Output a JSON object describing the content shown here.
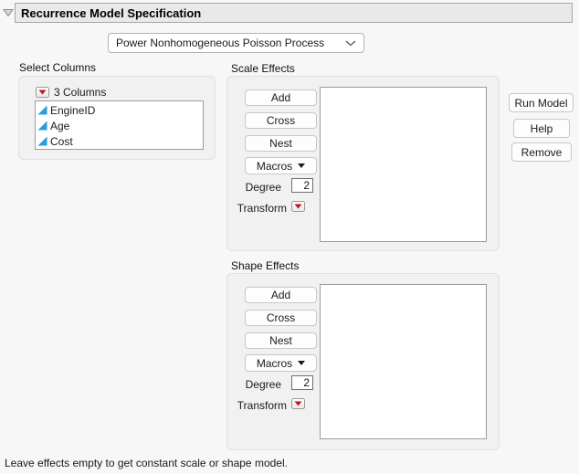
{
  "header": {
    "title": "Recurrence Model Specification"
  },
  "model_selector": {
    "value": "Power Nonhomogeneous Poisson Process"
  },
  "select_columns": {
    "label": "Select Columns",
    "menu_label": "3 Columns",
    "columns": [
      {
        "name": "EngineID",
        "icon": "continuous-column-icon"
      },
      {
        "name": "Age",
        "icon": "continuous-column-icon"
      },
      {
        "name": "Cost",
        "icon": "continuous-column-icon"
      }
    ]
  },
  "scale_effects": {
    "label": "Scale Effects",
    "add": "Add",
    "cross": "Cross",
    "nest": "Nest",
    "macros": "Macros",
    "degree_label": "Degree",
    "degree_value": "2",
    "transform_label": "Transform",
    "effects": []
  },
  "shape_effects": {
    "label": "Shape Effects",
    "add": "Add",
    "cross": "Cross",
    "nest": "Nest",
    "macros": "Macros",
    "degree_label": "Degree",
    "degree_value": "2",
    "transform_label": "Transform",
    "effects": []
  },
  "actions": {
    "run_model": "Run Model",
    "help": "Help",
    "remove": "Remove"
  },
  "footer_note": "Leave effects empty to get constant scale or shape model.",
  "colors": {
    "red_menu": "#cc1020",
    "column_icon": "#2b9cd8"
  }
}
